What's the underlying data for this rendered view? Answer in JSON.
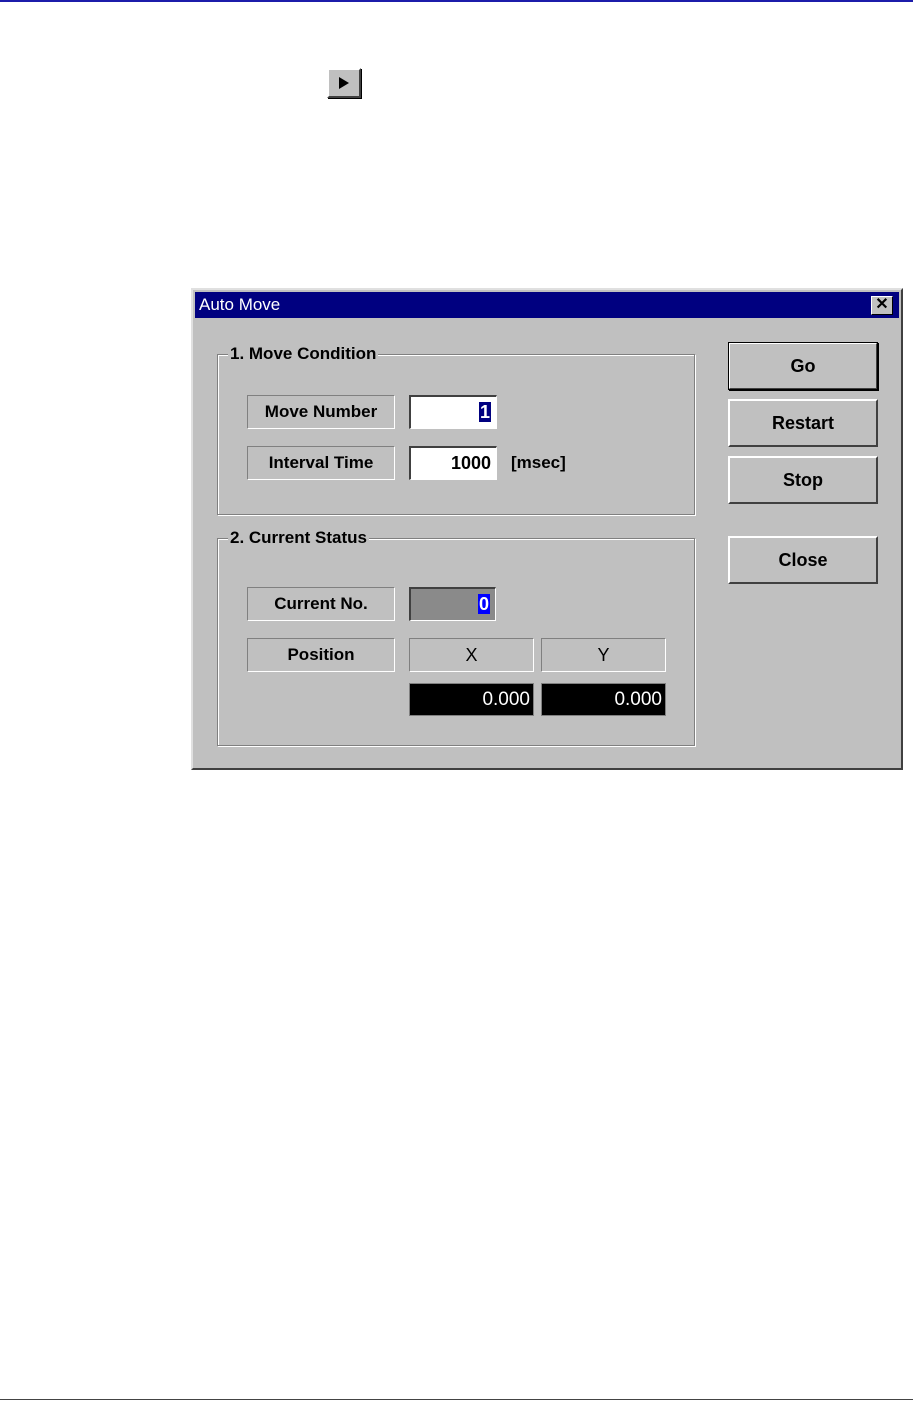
{
  "dialog": {
    "title": "Auto Move",
    "close_glyph": "✕"
  },
  "move_condition": {
    "caption": "1. Move Condition",
    "move_number_label": "Move Number",
    "move_number_value": "1",
    "interval_time_label": "Interval Time",
    "interval_time_value": "1000",
    "interval_unit": "[msec]"
  },
  "current_status": {
    "caption": "2. Current Status",
    "current_no_label": "Current No.",
    "current_no_value": "0",
    "position_label": "Position",
    "x_header": "X",
    "y_header": "Y",
    "x_value": "0.000",
    "y_value": "0.000"
  },
  "buttons": {
    "go": "Go",
    "restart": "Restart",
    "stop": "Stop",
    "close": "Close"
  },
  "icons": {
    "play": "play-icon",
    "close": "close-icon"
  },
  "colors": {
    "titlebar": "#000080",
    "face": "#c0c0c0",
    "display_bg": "#000000",
    "digit_highlight": "#0000ff"
  }
}
